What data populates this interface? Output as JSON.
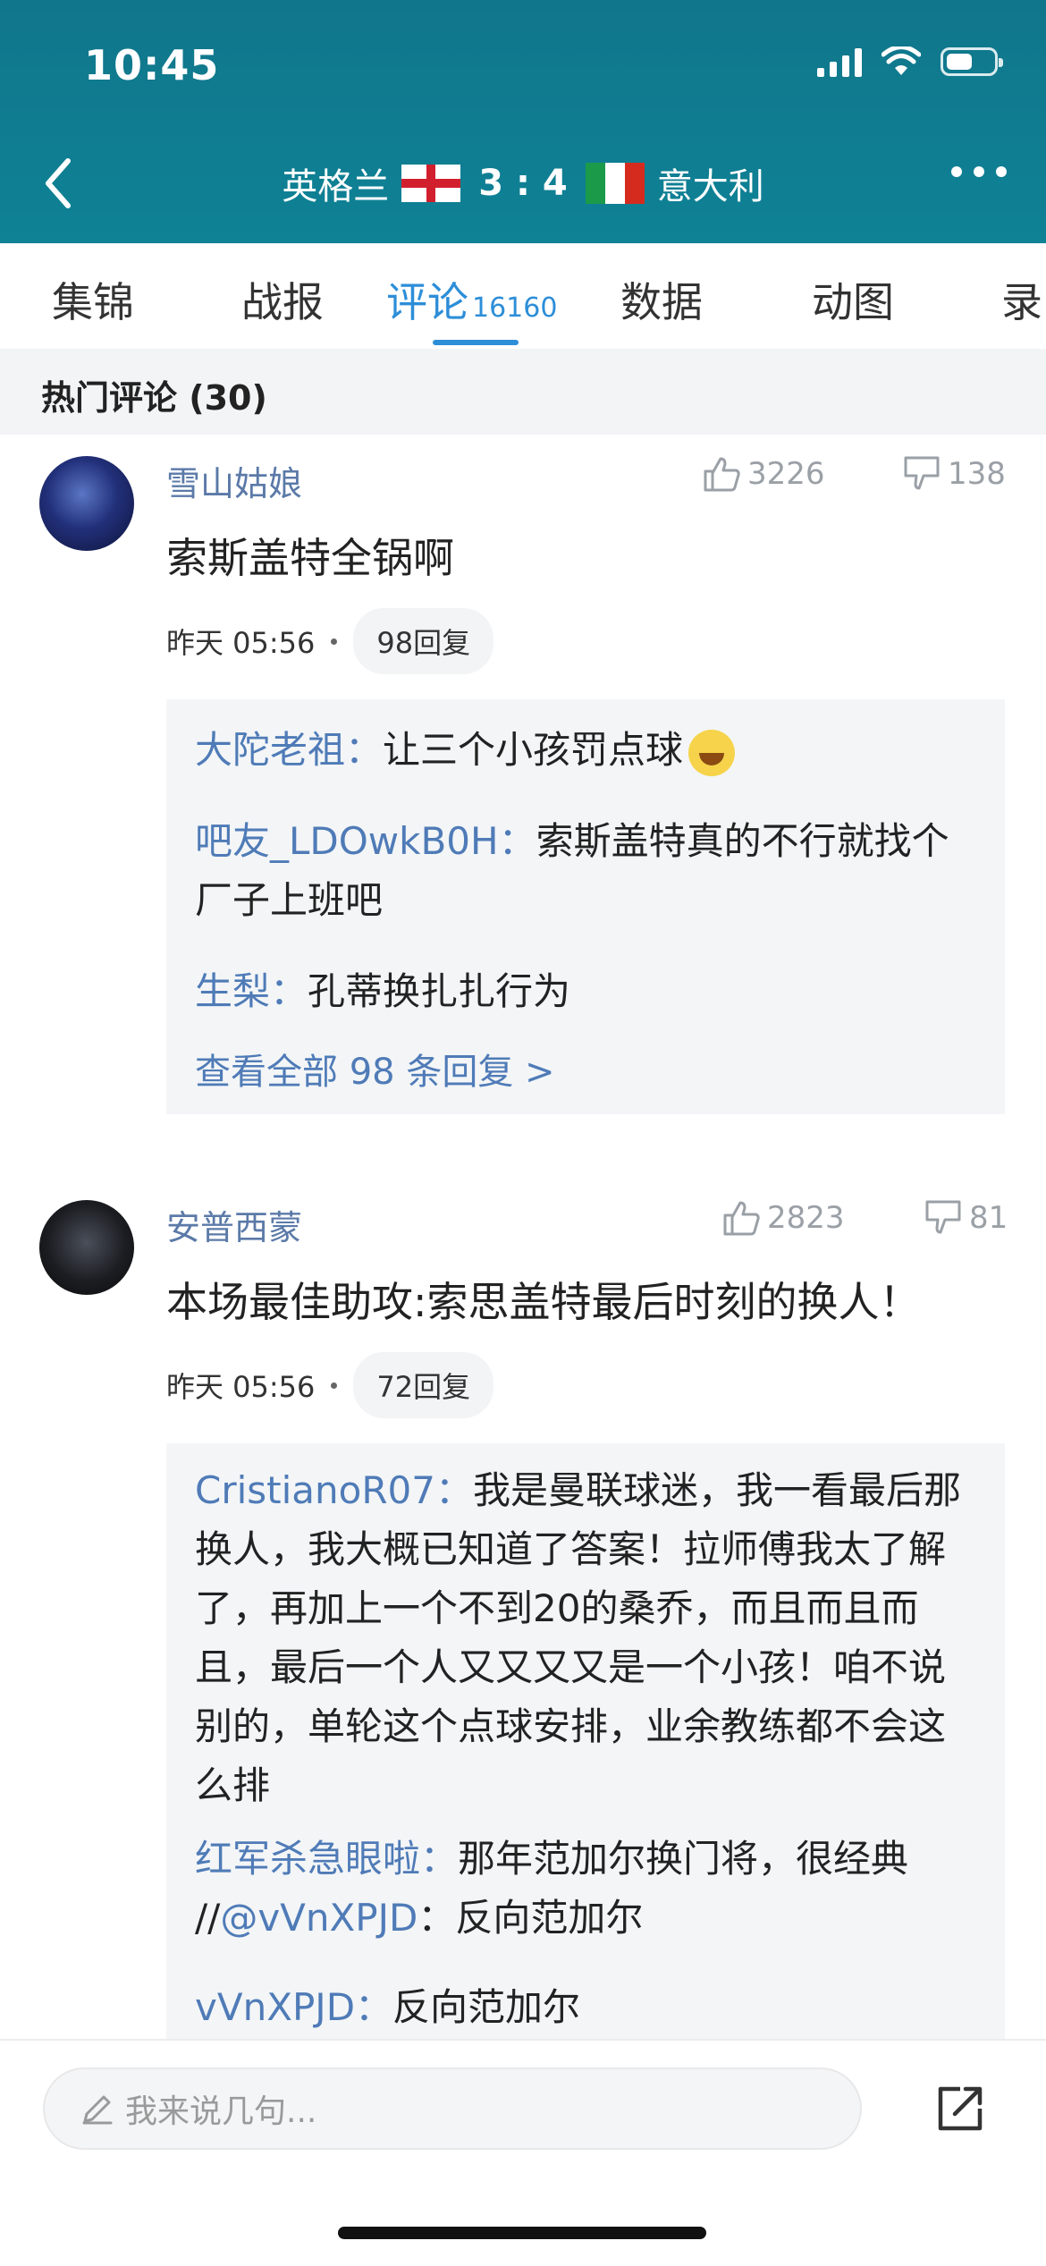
{
  "status_bar": {
    "time": "10:45"
  },
  "header": {
    "home_team": "英格兰",
    "score": "3 : 4",
    "away_team": "意大利",
    "flag_colors": {
      "england_cross": "#d21f2e",
      "italy": [
        "#1b9a4a",
        "#ffffff",
        "#d52b1e"
      ]
    }
  },
  "tabs": [
    {
      "label": "集锦"
    },
    {
      "label": "战报"
    },
    {
      "label": "评论",
      "count": "16160",
      "active": true
    },
    {
      "label": "数据"
    },
    {
      "label": "动图"
    },
    {
      "label": "录"
    }
  ],
  "section": {
    "title": "热门评论 (30)"
  },
  "comments": [
    {
      "user": "雪山姑娘",
      "likes": "3226",
      "dislikes": "138",
      "text": "索斯盖特全锅啊",
      "time": "昨天 05:56",
      "reply_count": "98回复",
      "replies": [
        {
          "name": "大陀老祖：",
          "text": "让三个小孩罚点球"
        },
        {
          "name": "吧友_LDOwkB0H：",
          "text": "索斯盖特真的不行就找个厂子上班吧"
        },
        {
          "name": "生梨：",
          "text": "孔蒂换扎扎行为"
        }
      ],
      "view_all": "查看全部 98 条回复 >"
    },
    {
      "user": "安普西蒙",
      "likes": "2823",
      "dislikes": "81",
      "text": "本场最佳助攻:索思盖特最后时刻的换人！",
      "time": "昨天 05:56",
      "reply_count": "72回复",
      "replies": [
        {
          "name": "CristianoR07：",
          "text": "我是曼联球迷，我一看最后那换人，我大概已知道了答案！拉师傅我太了解了，再加上一个不到20的桑乔，而且而且而且，最后一个人又又又又是一个小孩！咱不说别的，单轮这个点球安排，业余教练都不会这么排"
        },
        {
          "name": "红军杀急眼啦：",
          "text": "那年范加尔换门将，很经典 //",
          "mention": "@vVnXPJD",
          "mention_text": "：反向范加尔"
        },
        {
          "name": "vVnXPJD：",
          "text": "反向范加尔"
        }
      ]
    }
  ],
  "input": {
    "placeholder": "我来说几句..."
  },
  "colors": {
    "header_teal": "#0f7d92",
    "accent_blue": "#2d8ed8",
    "link_blue": "#4f7bb7"
  }
}
